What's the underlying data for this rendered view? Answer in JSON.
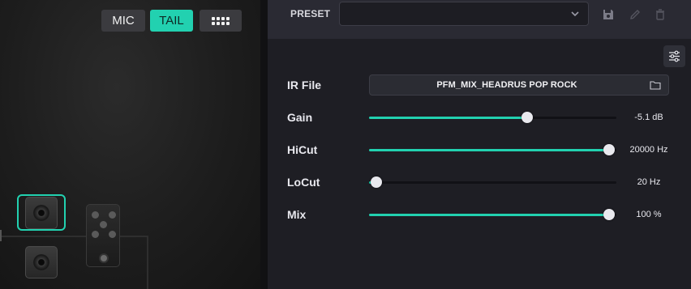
{
  "canvas": {
    "mode_buttons": {
      "mic_label": "MIC",
      "tail_label": "TAIL",
      "grid_icon": "grid-icon"
    },
    "accent_color": "#22d1b0"
  },
  "preset": {
    "label": "PRESET",
    "selected_value": "",
    "save_icon": "save-icon",
    "edit_icon": "pencil-icon",
    "delete_icon": "trash-icon"
  },
  "settings_icon": "sliders-icon",
  "ir_file": {
    "label": "IR File",
    "value": "PFM_MIX_HEADRUS POP ROCK",
    "folder_icon": "folder-icon"
  },
  "controls": [
    {
      "label": "Gain",
      "value_text": "-5.1 dB",
      "level": 0.64
    },
    {
      "label": "HiCut",
      "value_text": "20000 Hz",
      "level": 0.97
    },
    {
      "label": "LoCut",
      "value_text": "20 Hz",
      "level": 0.03
    },
    {
      "label": "Mix",
      "value_text": "100 %",
      "level": 0.97
    }
  ]
}
